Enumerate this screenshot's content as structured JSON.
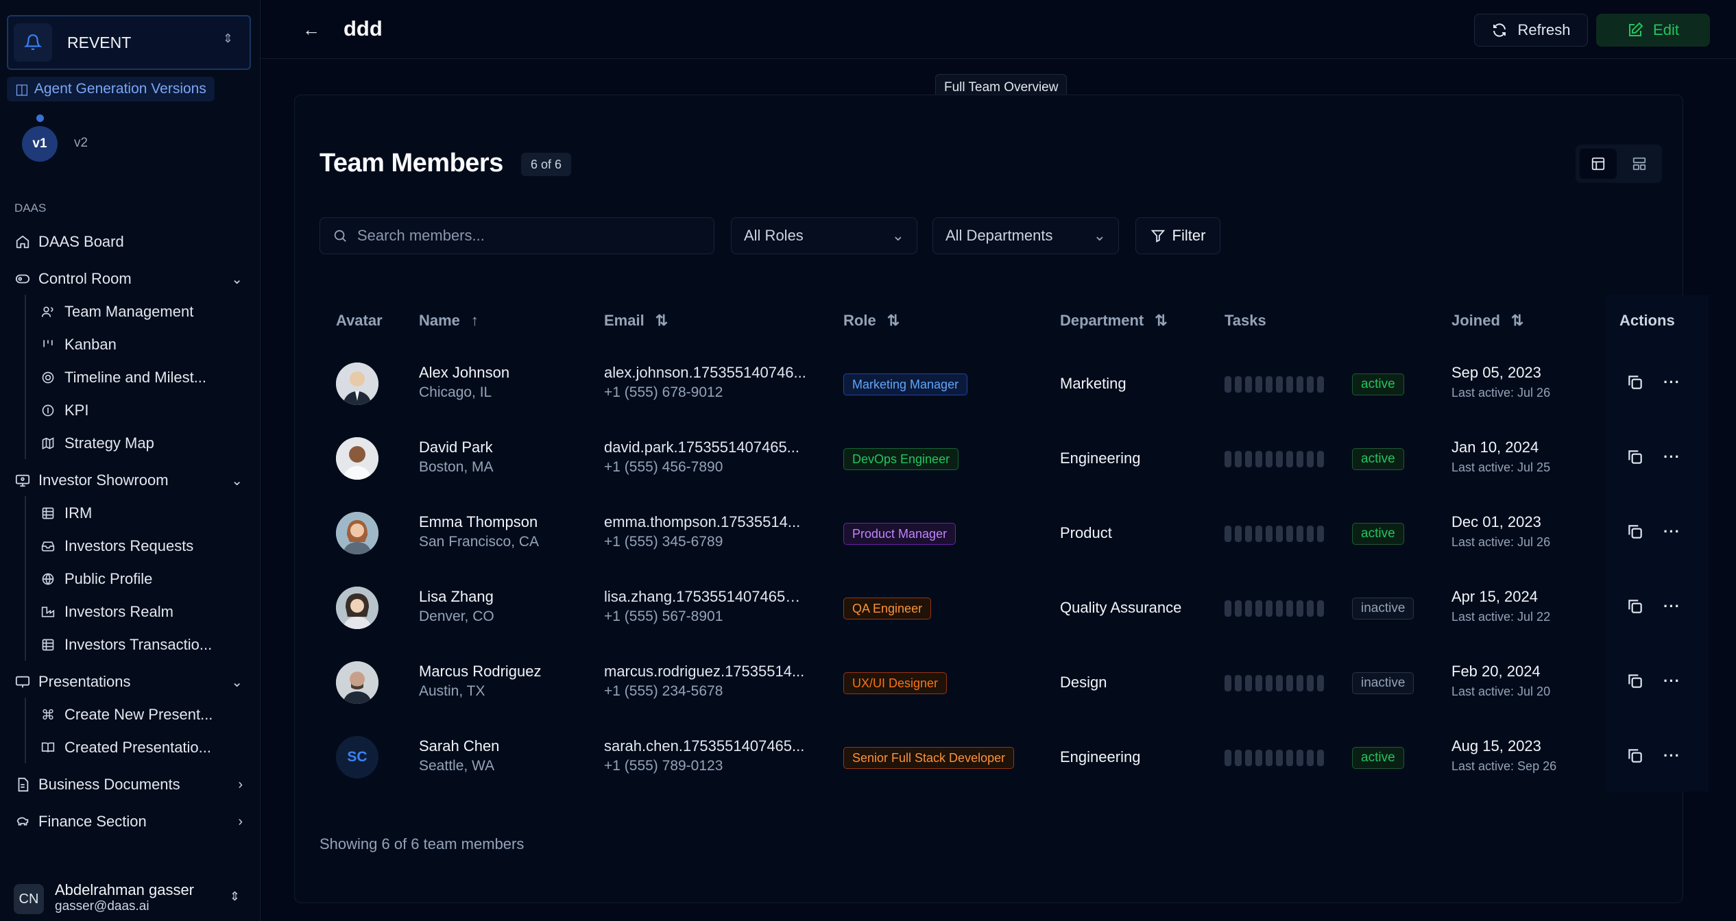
{
  "brand": {
    "name": "REVENT"
  },
  "agent_versions": {
    "label": "Agent Generation Versions",
    "current": "v1",
    "other": "v2"
  },
  "sidebar": {
    "section": "DAAS",
    "items": [
      {
        "label": "DAAS Board"
      },
      {
        "label": "Control Room"
      },
      {
        "label": "Team Management"
      },
      {
        "label": "Kanban"
      },
      {
        "label": "Timeline and Milest..."
      },
      {
        "label": "KPI"
      },
      {
        "label": "Strategy Map"
      },
      {
        "label": "Investor Showroom"
      },
      {
        "label": "IRM"
      },
      {
        "label": "Investors Requests"
      },
      {
        "label": "Public Profile"
      },
      {
        "label": "Investors Realm"
      },
      {
        "label": "Investors Transactio..."
      },
      {
        "label": "Presentations"
      },
      {
        "label": "Create New Present..."
      },
      {
        "label": "Created Presentatio..."
      },
      {
        "label": "Business Documents"
      },
      {
        "label": "Finance Section"
      }
    ]
  },
  "user": {
    "initials": "CN",
    "name": "Abdelrahman gasser",
    "email": "gasser@daas.ai"
  },
  "header": {
    "title": "ddd",
    "refresh": "Refresh",
    "edit": "Edit",
    "tooltip": "Full Team Overview"
  },
  "team": {
    "title": "Team Members",
    "count": "6 of 6",
    "search_placeholder": "Search members...",
    "roles_filter": "All Roles",
    "departments_filter": "All Departments",
    "filter_button": "Filter",
    "columns": {
      "avatar": "Avatar",
      "name": "Name",
      "email": "Email",
      "role": "Role",
      "department": "Department",
      "tasks": "Tasks",
      "joined": "Joined",
      "actions": "Actions"
    },
    "rows": [
      {
        "name": "Alex Johnson",
        "location": "Chicago, IL",
        "email": "alex.johnson.175355140746...",
        "phone": "+1 (555) 678-9012",
        "role": "Marketing Manager",
        "role_color": "#60a5fa",
        "department": "Marketing",
        "status": "active",
        "joined": "Sep 05, 2023",
        "last_active": "Last active: Jul 26"
      },
      {
        "name": "David Park",
        "location": "Boston, MA",
        "email": "david.park.1753551407465...",
        "phone": "+1 (555) 456-7890",
        "role": "DevOps Engineer",
        "role_color": "#22c55e",
        "department": "Engineering",
        "status": "active",
        "joined": "Jan 10, 2024",
        "last_active": "Last active: Jul 25"
      },
      {
        "name": "Emma Thompson",
        "location": "San Francisco, CA",
        "email": "emma.thompson.17535514...",
        "phone": "+1 (555) 345-6789",
        "role": "Product Manager",
        "role_color": "#c084fc",
        "department": "Product",
        "status": "active",
        "joined": "Dec 01, 2023",
        "last_active": "Last active: Jul 26"
      },
      {
        "name": "Lisa Zhang",
        "location": "Denver, CO",
        "email": "lisa.zhang.1753551407465@...",
        "phone": "+1 (555) 567-8901",
        "role": "QA Engineer",
        "role_color": "#fb923c",
        "department": "Quality Assurance",
        "status": "inactive",
        "joined": "Apr 15, 2024",
        "last_active": "Last active: Jul 22"
      },
      {
        "name": "Marcus Rodriguez",
        "location": "Austin, TX",
        "email": "marcus.rodriguez.17535514...",
        "phone": "+1 (555) 234-5678",
        "role": "UX/UI Designer",
        "role_color": "#f97316",
        "department": "Design",
        "status": "inactive",
        "joined": "Feb 20, 2024",
        "last_active": "Last active: Jul 20"
      },
      {
        "name": "Sarah Chen",
        "location": "Seattle, WA",
        "initials": "SC",
        "email": "sarah.chen.1753551407465...",
        "phone": "+1 (555) 789-0123",
        "role": "Senior Full Stack Developer",
        "role_color": "#fb923c",
        "department": "Engineering",
        "status": "active",
        "joined": "Aug 15, 2023",
        "last_active": "Last active: Sep 26"
      }
    ],
    "footer": "Showing 6 of 6 team members"
  }
}
